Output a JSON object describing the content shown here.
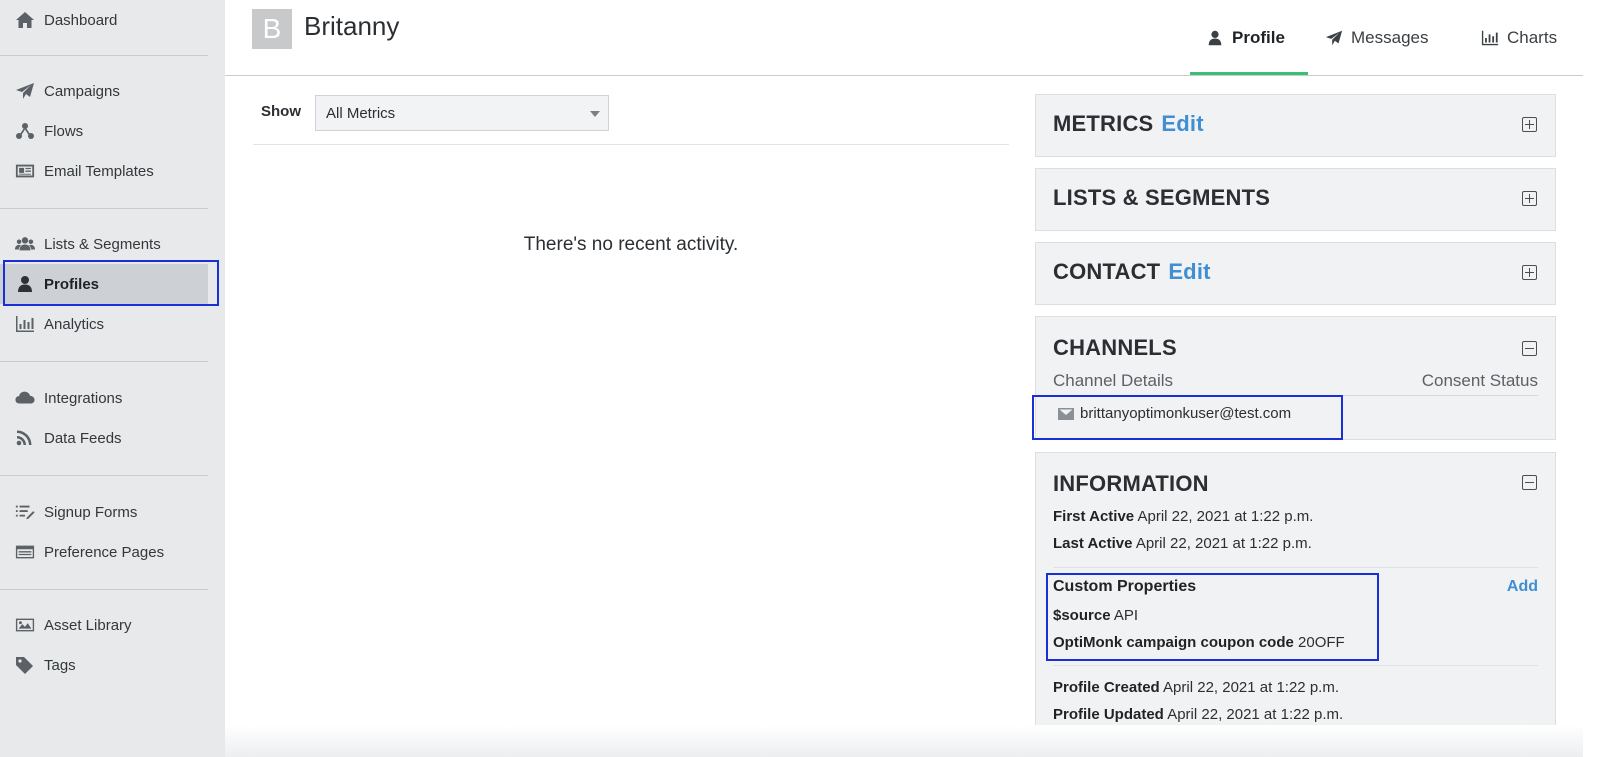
{
  "sidebar": {
    "items": [
      {
        "label": "Dashboard",
        "icon": "home-icon"
      },
      {
        "label": "Campaigns",
        "icon": "paper-plane-icon"
      },
      {
        "label": "Flows",
        "icon": "flow-icon"
      },
      {
        "label": "Email Templates",
        "icon": "newspaper-icon"
      },
      {
        "label": "Lists & Segments",
        "icon": "users-icon"
      },
      {
        "label": "Profiles",
        "icon": "user-icon"
      },
      {
        "label": "Analytics",
        "icon": "bar-chart-icon"
      },
      {
        "label": "Integrations",
        "icon": "cloud-icon"
      },
      {
        "label": "Data Feeds",
        "icon": "rss-icon"
      },
      {
        "label": "Signup Forms",
        "icon": "list-icon"
      },
      {
        "label": "Preference Pages",
        "icon": "browser-window-icon"
      },
      {
        "label": "Asset Library",
        "icon": "image-icon"
      },
      {
        "label": "Tags",
        "icon": "tag-icon"
      }
    ],
    "active": "Profiles"
  },
  "header": {
    "avatar_letter": "B",
    "name": "Britanny",
    "tabs": [
      {
        "label": "Profile",
        "icon": "user-icon",
        "active": true
      },
      {
        "label": "Messages",
        "icon": "paper-plane-icon",
        "active": false
      },
      {
        "label": "Charts",
        "icon": "bar-chart-icon",
        "active": false
      }
    ]
  },
  "activity": {
    "show_label": "Show",
    "filter_value": "All Metrics",
    "empty_message": "There's no recent activity."
  },
  "panels": {
    "metrics": {
      "title": "METRICS",
      "edit": "Edit"
    },
    "lists": {
      "title": "LISTS & SEGMENTS"
    },
    "contact": {
      "title": "CONTACT",
      "edit": "Edit"
    },
    "channels": {
      "title": "CHANNELS",
      "col_details": "Channel Details",
      "col_consent": "Consent Status",
      "email": "brittanyoptimonkuser@test.com"
    },
    "information": {
      "title": "INFORMATION",
      "first_active_label": "First Active",
      "first_active_value": "April 22, 2021 at 1:22 p.m.",
      "last_active_label": "Last Active",
      "last_active_value": "April 22, 2021 at 1:22 p.m.",
      "custom_properties_label": "Custom Properties",
      "add_label": "Add",
      "source_label": "$source",
      "source_value": "API",
      "coupon_label": "OptiMonk campaign coupon code",
      "coupon_value": "20OFF",
      "created_label": "Profile Created",
      "created_value": "April 22, 2021 at 1:22 p.m.",
      "updated_label": "Profile Updated",
      "updated_value": "April 22, 2021 at 1:22 p.m."
    }
  },
  "colors": {
    "accent_link": "#3f8fd2",
    "active_tab_underline": "#3bbf72",
    "highlight_box": "#1a2fd6",
    "sidebar_bg": "#e7e9eb"
  }
}
